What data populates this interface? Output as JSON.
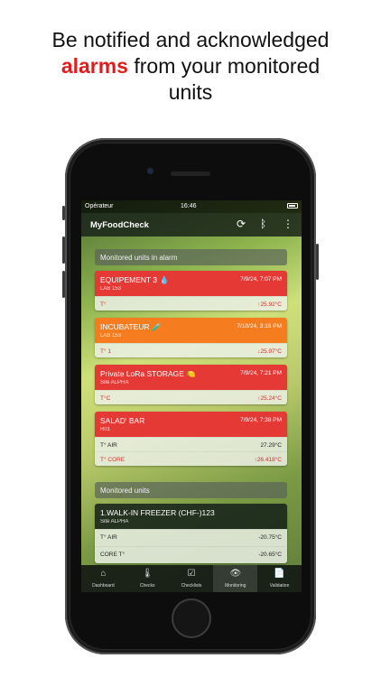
{
  "headline": {
    "line1": "Be notified and acknowledged",
    "highlight": "alarms",
    "line2_rest": " from your monitored",
    "line3": "units"
  },
  "statusbar": {
    "carrier": "Opérateur",
    "time": "16:46"
  },
  "app": {
    "title": "MyFoodCheck"
  },
  "alarm_section": {
    "title": "Monitored units in alarm"
  },
  "alarm_units": [
    {
      "name": "EQUIPEMENT 3",
      "icon": "💧",
      "site": "LAB 153",
      "date": "7/9/24, 7:07 PM",
      "color": "#e53935",
      "rows": [
        {
          "label": "T°",
          "value": "↑25.92°C"
        }
      ]
    },
    {
      "name": "INCUBATEUR",
      "icon": "🧪",
      "site": "LAB 153",
      "date": "7/10/24, 3:16 PM",
      "color": "#f57c1f",
      "rows": [
        {
          "label": "T° 1",
          "value": "↓25.97°C"
        }
      ]
    },
    {
      "name": "Private LoRa STORAGE",
      "icon": "🍋",
      "site": "Site ALPHA",
      "date": "7/9/24, 7:21 PM",
      "color": "#e53935",
      "rows": [
        {
          "label": "T°C",
          "value": "↑25.24°C"
        }
      ]
    },
    {
      "name": "SALAD' BAR",
      "icon": "",
      "site": "R01",
      "date": "7/9/24, 7:38 PM",
      "color": "#e53935",
      "rows": [
        {
          "label": "T° AIR",
          "value": "27.29°C"
        },
        {
          "label": "T° CORE",
          "value": "↑26.418°C"
        }
      ]
    }
  ],
  "monitored_section": {
    "title": "Monitored units"
  },
  "monitored_units": [
    {
      "name": "1.WALK-IN FREEZER (CHF-)123",
      "site": "Site ALPHA",
      "rows": [
        {
          "label": "T° AIR",
          "value": "-20.75°C"
        },
        {
          "label": "CORE T°",
          "value": "-20.65°C"
        }
      ]
    }
  ],
  "tabs": [
    {
      "label": "Dashboard",
      "icon": "home-icon",
      "glyph": "⌂"
    },
    {
      "label": "Checks",
      "icon": "thermometer-icon",
      "glyph": "🌡"
    },
    {
      "label": "Checklists",
      "icon": "checklist-icon",
      "glyph": "☑"
    },
    {
      "label": "Monitoring",
      "icon": "eye-icon",
      "glyph": "👁"
    },
    {
      "label": "Validation",
      "icon": "document-icon",
      "glyph": "📄"
    }
  ]
}
